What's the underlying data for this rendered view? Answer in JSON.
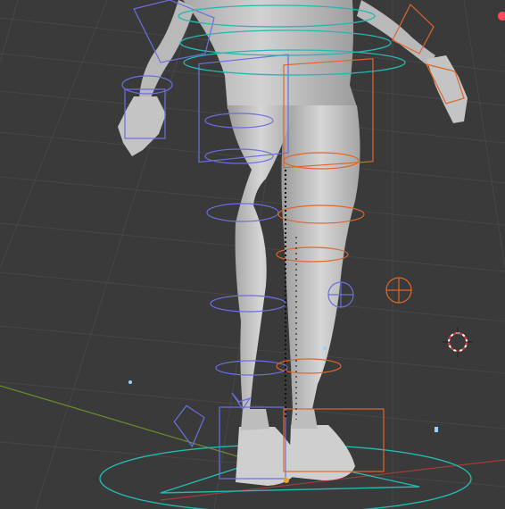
{
  "app": {
    "name": "",
    "view": "3D Viewport"
  },
  "scene": {
    "description_visible": false
  },
  "colors": {
    "background": "#3a3a3a",
    "grid": "#474747",
    "mesh": "#c9c9c9",
    "mesh_shadow": "#8f8f8f",
    "rig_left": "#6b6fe0",
    "rig_right": "#e0662a",
    "rig_center": "#22b9b0",
    "x_axis": "#a33b3b",
    "y_axis": "#6a8c2b",
    "cursor_red": "#e23a3a",
    "status_dot": "#ff4a5e"
  },
  "icons": {
    "status_dot": "record-dot-icon",
    "cursor": "3d-cursor-icon"
  }
}
